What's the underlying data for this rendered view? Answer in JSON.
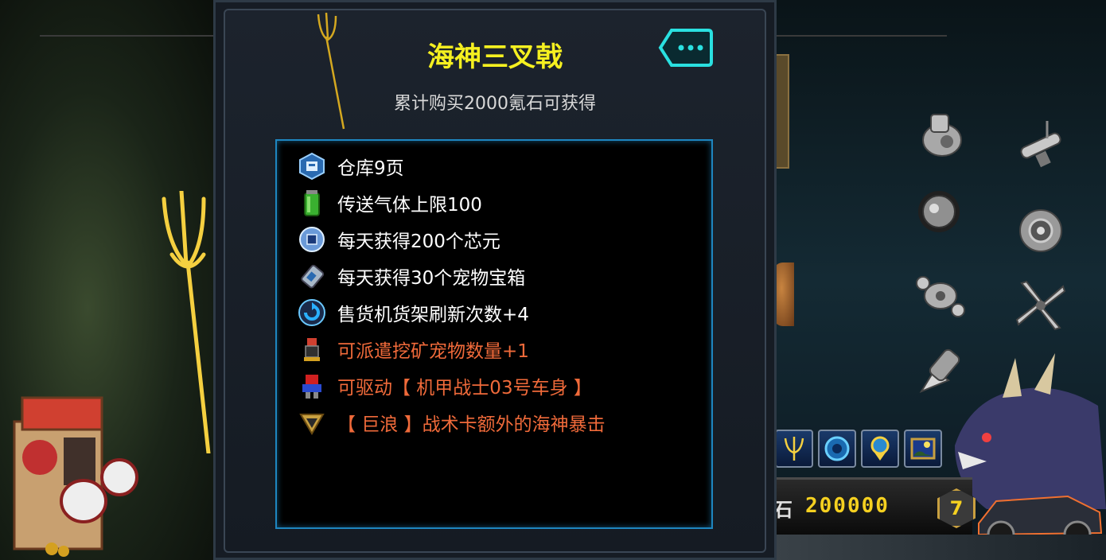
{
  "panel": {
    "title": "海神三叉戟",
    "subtitle": "累计购买2000氪石可获得"
  },
  "benefits": [
    {
      "icon": "warehouse-icon",
      "text": "仓库9页",
      "highlight": false
    },
    {
      "icon": "gas-canister-icon",
      "text": "传送气体上限100",
      "highlight": false
    },
    {
      "icon": "chip-coin-icon",
      "text": "每天获得200个芯元",
      "highlight": false
    },
    {
      "icon": "pet-box-icon",
      "text": "每天获得30个宠物宝箱",
      "highlight": false
    },
    {
      "icon": "refresh-icon",
      "text": "售货机货架刷新次数+4",
      "highlight": false
    },
    {
      "icon": "mining-pet-icon",
      "text": "可派遣挖矿宠物数量+1",
      "highlight": true
    },
    {
      "icon": "mecha-warrior-icon",
      "text": "可驱动【 机甲战士03号车身 】",
      "highlight": true
    },
    {
      "icon": "tactic-card-icon",
      "text": "【 巨浪 】战术卡额外的海神暴击",
      "highlight": true
    }
  ],
  "resource": {
    "label": "石",
    "value": "200000",
    "level": "7"
  },
  "colors": {
    "title": "#f5f020",
    "highlight": "#f06a3a",
    "frame": "#1e86c0",
    "value": "#f5d020"
  }
}
